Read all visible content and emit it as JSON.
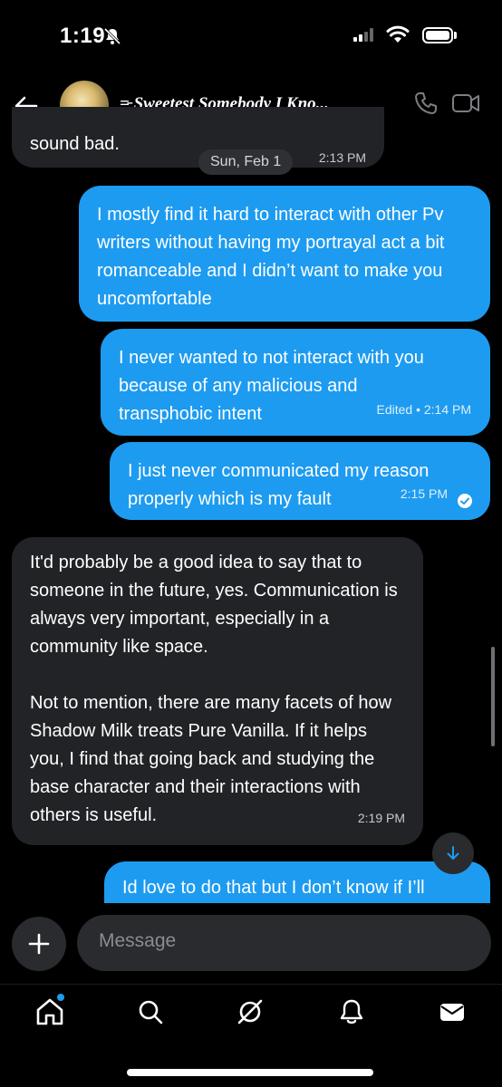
{
  "status_bar": {
    "time": "1:19"
  },
  "header": {
    "title": "=̵͟͟ Sweetest Somebody I Kno..."
  },
  "messages": [
    {
      "text": "sound bad.",
      "meta": "2:13 PM"
    },
    {
      "date": "Sun, Feb 1"
    },
    {
      "text": "I mostly find it hard to interact with other Pv writers without having my portrayal act a bit romanceable and I didn’t want to make you uncomfortable"
    },
    {
      "text": "I never wanted to not interact with you because of any malicious and transphobic intent",
      "meta": "Edited • 2:14 PM"
    },
    {
      "text": "I just never communicated my reason properly which is my fault",
      "meta": "2:15 PM"
    },
    {
      "text_p1": "It'd probably be a good idea to say that to someone in the future, yes. Communication is always very important, especially in a community like space.",
      "text_p2": "Not to mention, there are many facets of how Shadow Milk treats Pure Vanilla. If it helps you, I find that going back and studying the base character and their interactions with others is useful.",
      "meta": "2:19 PM"
    },
    {
      "text": "Id love to do that but I don’t know if I’ll"
    }
  ],
  "composer": {
    "placeholder": "Message"
  },
  "icons": {
    "back": "arrow-left-icon",
    "phone": "phone-icon",
    "video": "video-icon",
    "plus": "plus-icon",
    "scroll": "arrow-down-icon",
    "tabs": [
      "home-icon",
      "search-icon",
      "grok-icon",
      "bell-icon",
      "mail-icon"
    ]
  },
  "colors": {
    "outgoing_bubble": "#1d9bf0",
    "incoming_bubble": "#222326",
    "background": "#000000"
  }
}
